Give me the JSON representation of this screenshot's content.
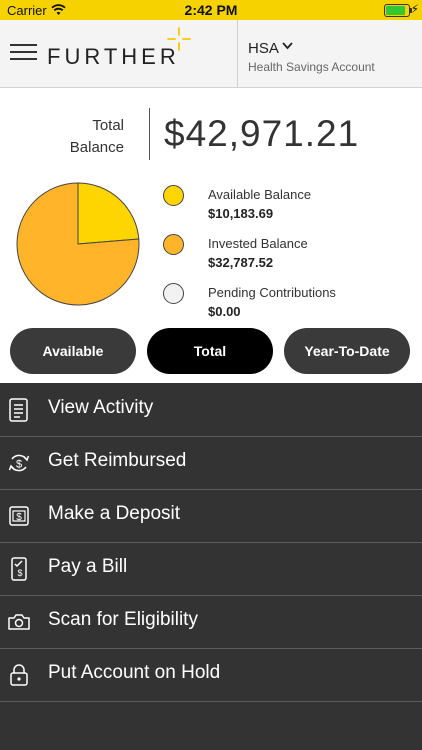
{
  "status_bar": {
    "carrier": "Carrier",
    "time": "2:42 PM"
  },
  "header": {
    "logo": "FURTHER",
    "account": {
      "name": "HSA",
      "subtitle": "Health Savings Account"
    }
  },
  "balance": {
    "label_line1": "Total",
    "label_line2": "Balance",
    "amount": "$42,971.21"
  },
  "colors": {
    "brand_yellow": "#f6d200",
    "available": "#ffd500",
    "invested": "#ffb42a",
    "pending": "#f2f2f2",
    "menu_bg": "#333333"
  },
  "chart_data": {
    "type": "pie",
    "slices": [
      {
        "label": "Available Balance",
        "value": 10183.69,
        "color": "#ffd500"
      },
      {
        "label": "Invested Balance",
        "value": 32787.52,
        "color": "#ffb42a"
      },
      {
        "label": "Pending Contributions",
        "value": 0.0,
        "color": "#f2f2f2"
      }
    ]
  },
  "legend": [
    {
      "name": "Available Balance",
      "value": "$10,183.69"
    },
    {
      "name": "Invested Balance",
      "value": "$32,787.52"
    },
    {
      "name": "Pending Contributions",
      "value": "$0.00"
    }
  ],
  "tabs": [
    {
      "label": "Available",
      "active": false
    },
    {
      "label": "Total",
      "active": true
    },
    {
      "label": "Year-To-Date",
      "active": false
    }
  ],
  "menu": [
    {
      "label": "View Activity",
      "icon": "document-list-icon"
    },
    {
      "label": "Get Reimbursed",
      "icon": "dollar-cycle-icon"
    },
    {
      "label": "Make a Deposit",
      "icon": "check-deposit-icon"
    },
    {
      "label": "Pay a Bill",
      "icon": "phone-bill-icon"
    },
    {
      "label": "Scan for Eligibility",
      "icon": "camera-icon"
    },
    {
      "label": "Put Account on Hold",
      "icon": "lock-icon"
    }
  ]
}
